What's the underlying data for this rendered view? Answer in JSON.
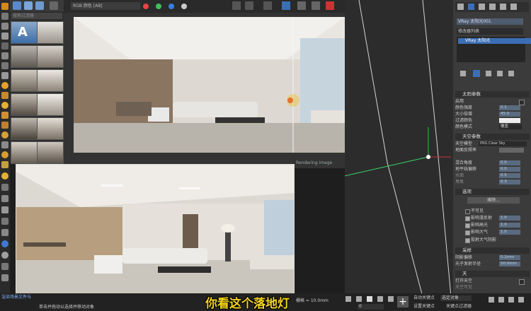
{
  "vfb": {
    "display_dropdown": "RGB 颜色 [AB]",
    "rendering_status": "Rendering image"
  },
  "thumbnails": {
    "search_placeholder": "搜索过滤器",
    "badge_letter": "A"
  },
  "command_panel": {
    "object_name": "VRay 太阳光001",
    "modifier_list": "修改器列表",
    "stack_item": "VRay 太阳光",
    "sun_params": {
      "header": "太阳参数",
      "enabled_label": "启用",
      "turbidity_label": "颜色强度",
      "turbidity_value": "0.1",
      "size_mult_label": "大小倍增",
      "size_mult_value": "45.0",
      "filter_color_label": "过滤颜色",
      "color_mode_label": "颜色模式",
      "color_mode_value": "覆盖"
    },
    "sky_params": {
      "header": "天空参数",
      "sky_model_label": "天空模型",
      "sky_model_value": "PRG Clear Sky",
      "ground_albedo_label": "地面反照率",
      "horizon_label": "混合角度",
      "horizon_value": "0.0",
      "horizon_offset_label": "地平线偏移",
      "horizon_offset_value": "0.0",
      "field_a_label": "水面",
      "field_a_value": "0.5",
      "field_b_label": "臭氧",
      "field_b_value": "0.3"
    },
    "options": {
      "header": "选项",
      "exclude_button": "排除...",
      "invisible_label": "不可见",
      "affect_diffuse_label": "影响漫反射",
      "affect_diffuse_value": "1.0",
      "affect_specular_label": "影响高光",
      "affect_specular_value": "1.0",
      "affect_atmosphere_label": "影响大气",
      "affect_atmosphere_value": "1.0",
      "cast_shadows_label": "投射大气阴影"
    },
    "sampling": {
      "header": "采样",
      "shadow_bias_label": "阴影偏移",
      "shadow_bias_value": "0.2mm",
      "photon_radius_label": "光子发射半径",
      "photon_radius_value": "50.0mm"
    },
    "sky_section": {
      "header": "天",
      "open_sky_label": "打开天空",
      "sky_vis_label": "天空可见"
    }
  },
  "bottom": {
    "left_status_1": "渲染场景文件与",
    "left_status_2": "单击并拖动以选择并移动对象",
    "grid": "栅格 = 10.0mm",
    "frame_value": "0",
    "auto_key": "自动关键点",
    "selected_set": "选定对象",
    "set_key": "设置关键点",
    "key_filters": "关键点过滤器",
    "subtitle": "你看这个落地灯"
  },
  "colors": {
    "accent_blue": "#3b6fb5",
    "subtitle_yellow": "#f2d21f",
    "red_marker": "#e03030"
  }
}
